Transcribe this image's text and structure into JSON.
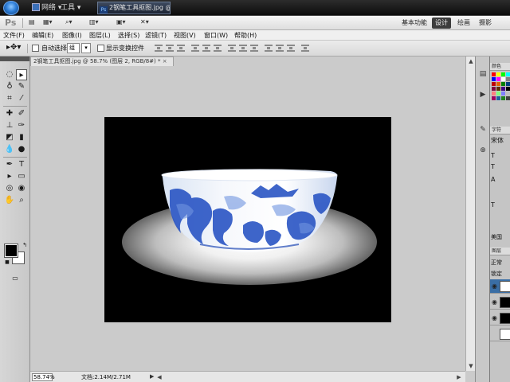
{
  "taskbar": {
    "items": [
      "网络",
      "工具"
    ],
    "active_task": "2钢笔工具抠图.jpg @..."
  },
  "appbar": {
    "logo": "Ps",
    "workspaces": [
      "基本功能",
      "设计",
      "绘画",
      "摄影"
    ],
    "active_workspace": "设计",
    "window_controls": [
      "—",
      "□",
      "×"
    ]
  },
  "menu": {
    "items": [
      "文件(F)",
      "编辑(E)",
      "图像(I)",
      "图层(L)",
      "选择(S)",
      "滤镜(T)",
      "视图(V)",
      "窗口(W)",
      "帮助(H)"
    ]
  },
  "options": {
    "auto_select_label": "自动选择:",
    "auto_select_value": "组",
    "show_transform_label": "显示变换控件"
  },
  "document": {
    "tab_title": "2钢笔工具抠图.jpg @ 58.7% (图层 2, RGB/8#) *",
    "tab_close": "×",
    "zoom": "58.74%",
    "doc_info": "文档:2.14M/2.71M"
  },
  "panels": {
    "color_tab": "颜色",
    "char_tab": "字符",
    "char_font": "宋体",
    "char_items": [
      "T",
      "T",
      "A",
      "T",
      "美国"
    ],
    "layers_tab": "图层",
    "blend_mode": "正常",
    "lock_label": "锁定"
  },
  "colors": {
    "canvas_bg": "#000000",
    "workspace_bg": "#cbcbcb",
    "accent": "#3d3d3d"
  }
}
